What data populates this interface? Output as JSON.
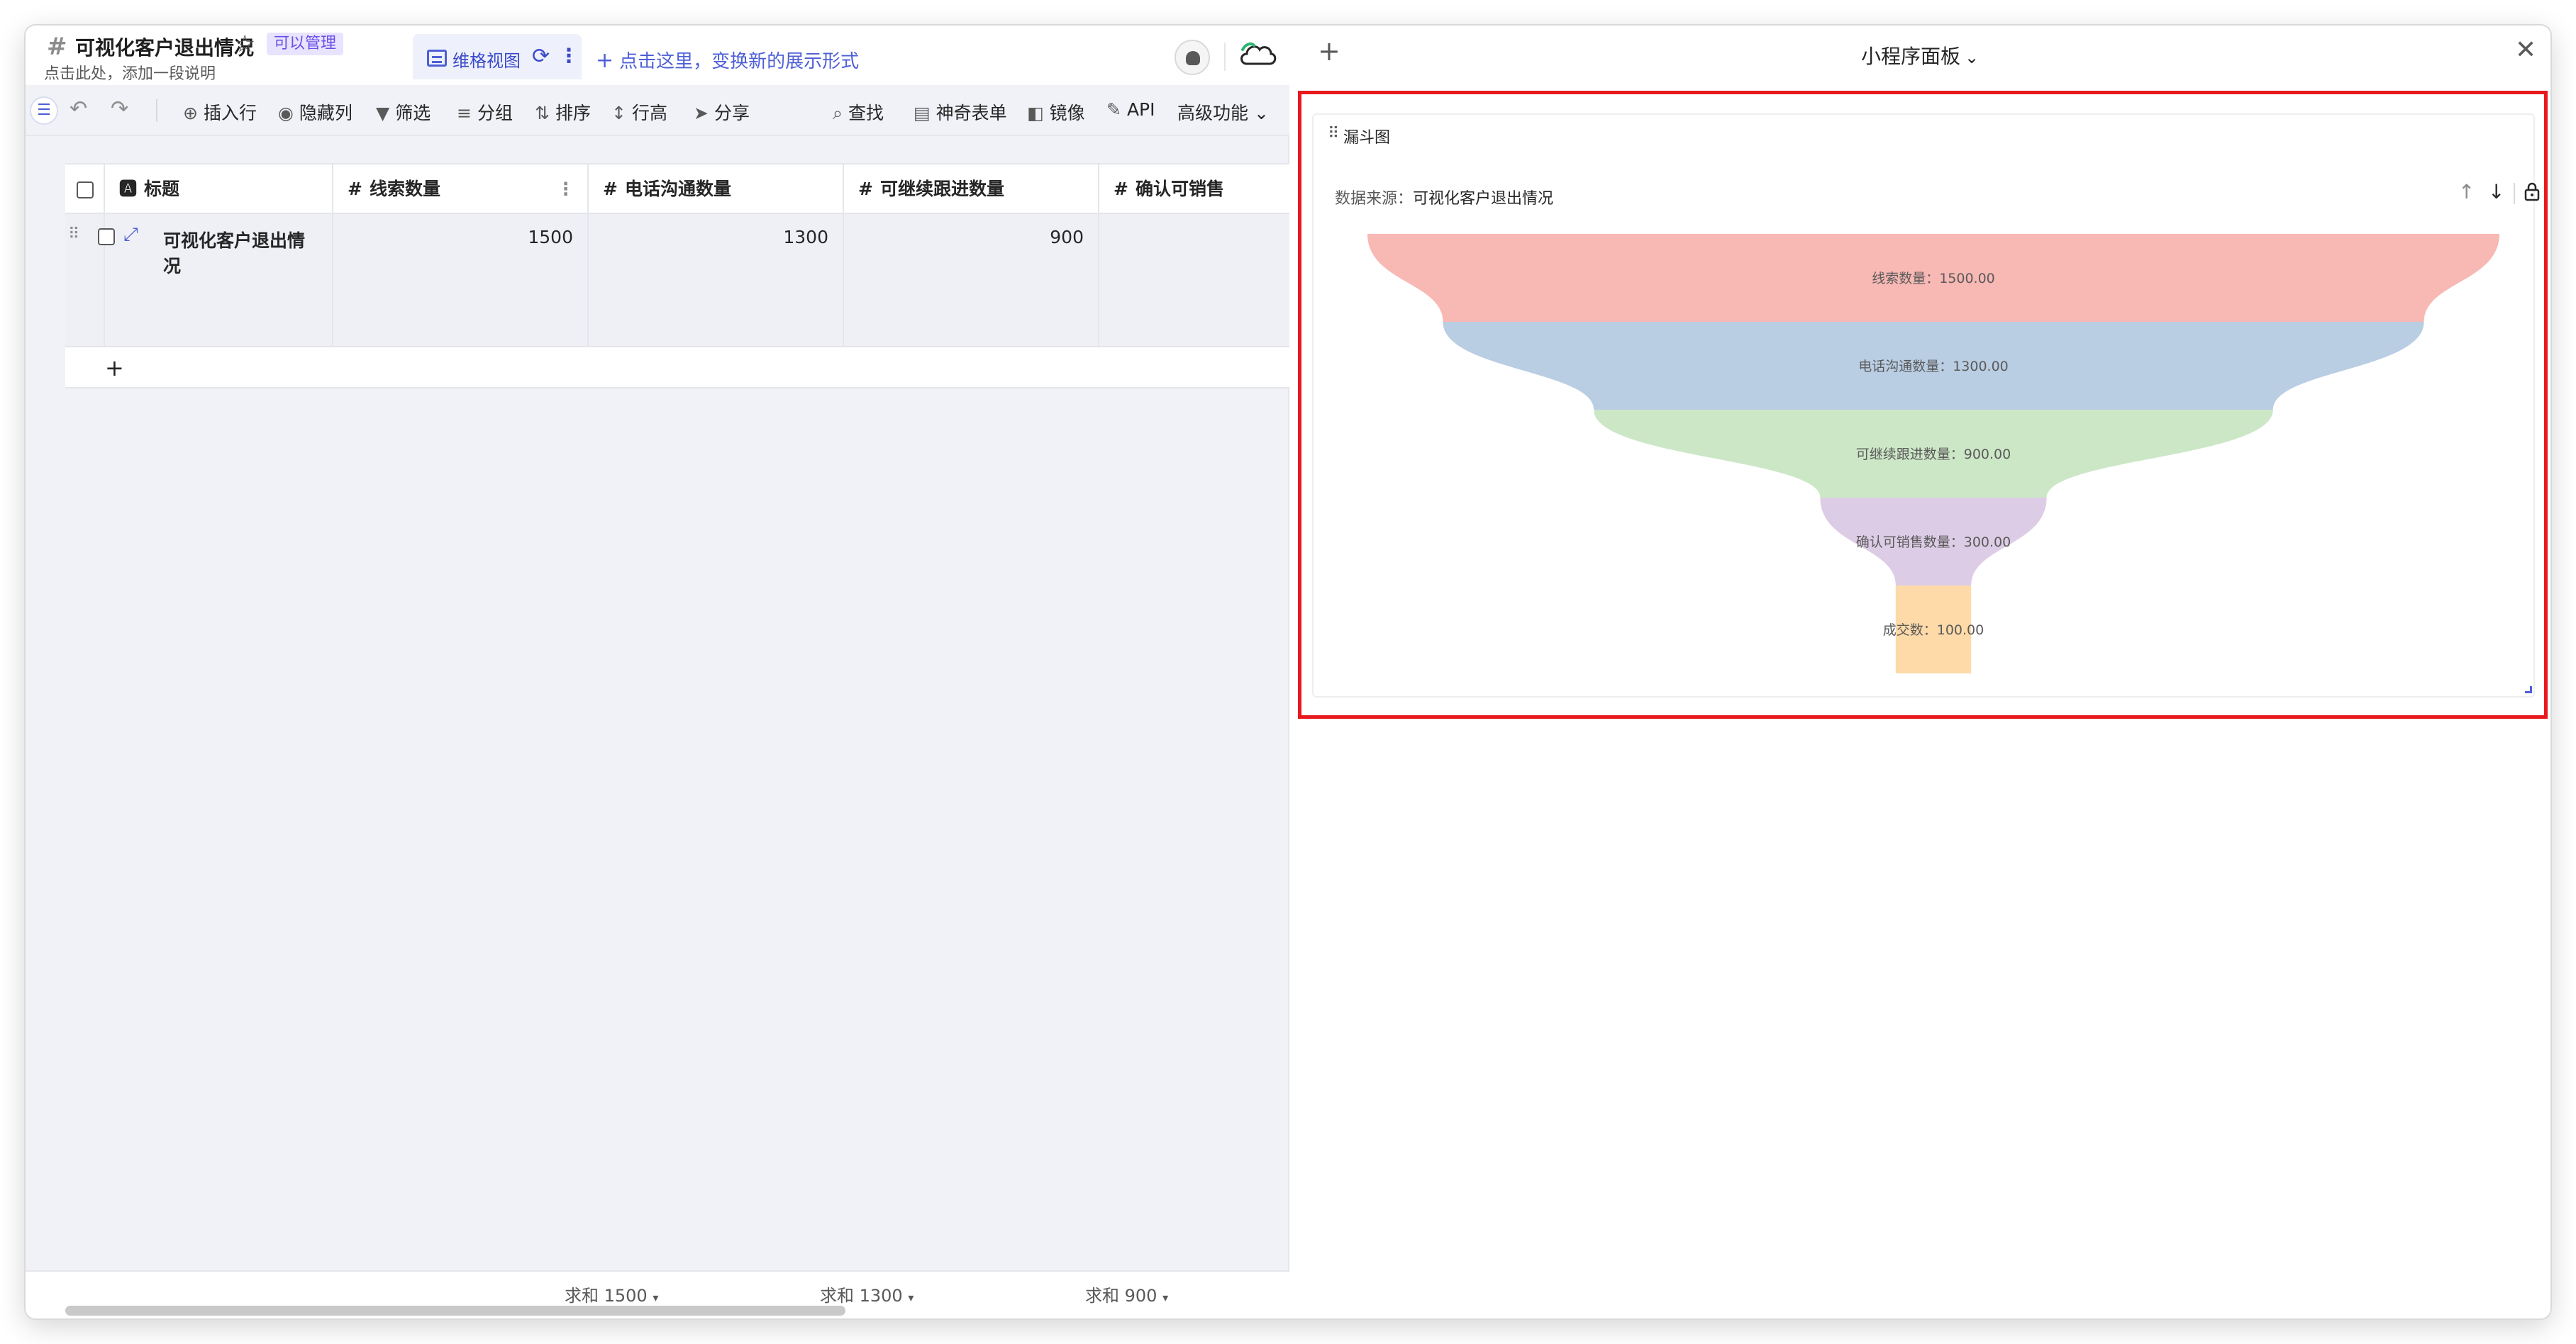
{
  "app": {
    "title": "可视化客户退出情况",
    "permission_badge": "可以管理",
    "description_placeholder": "点击此处，添加一段说明"
  },
  "view_tab": {
    "label": "维格视图",
    "new_view_prompt": "点击这里，变换新的展示形式"
  },
  "toolbar": {
    "insert_row": "插入行",
    "hide_columns": "隐藏列",
    "filter": "筛选",
    "group": "分组",
    "sort": "排序",
    "row_height": "行高",
    "share": "分享",
    "find": "查找",
    "magic_form": "神奇表单",
    "mirror": "镜像",
    "api": "API",
    "advanced": "高级功能"
  },
  "table": {
    "columns": [
      "标题",
      "线索数量",
      "电话沟通数量",
      "可继续跟进数量",
      "确认可销售"
    ],
    "rows": [
      {
        "title": "可视化客户退出情况",
        "values": [
          "1500",
          "1300",
          "900"
        ]
      }
    ]
  },
  "footer": {
    "sums": [
      "求和 1500",
      "求和 1300",
      "求和 900"
    ]
  },
  "panel": {
    "title": "小程序面板",
    "widget_title": "漏斗图",
    "data_source_label": "数据来源：",
    "data_source_value": "可视化客户退出情况"
  },
  "colors": {
    "accent": "#4e5fd6",
    "highlight_border": "#e8191c"
  },
  "chart_data": {
    "type": "funnel",
    "categories": [
      "线索数量",
      "电话沟通数量",
      "可继续跟进数量",
      "确认可销售数量",
      "成交数"
    ],
    "values": [
      1500,
      1300,
      900,
      300,
      100
    ],
    "labels": [
      "线索数量：1500.00",
      "电话沟通数量：1300.00",
      "可继续跟进数量：900.00",
      "确认可销售数量：300.00",
      "成交数：100.00"
    ],
    "colors": [
      "#f8b8b4",
      "#b9cde3",
      "#cce7c6",
      "#ddcce6",
      "#fddaa8"
    ]
  }
}
